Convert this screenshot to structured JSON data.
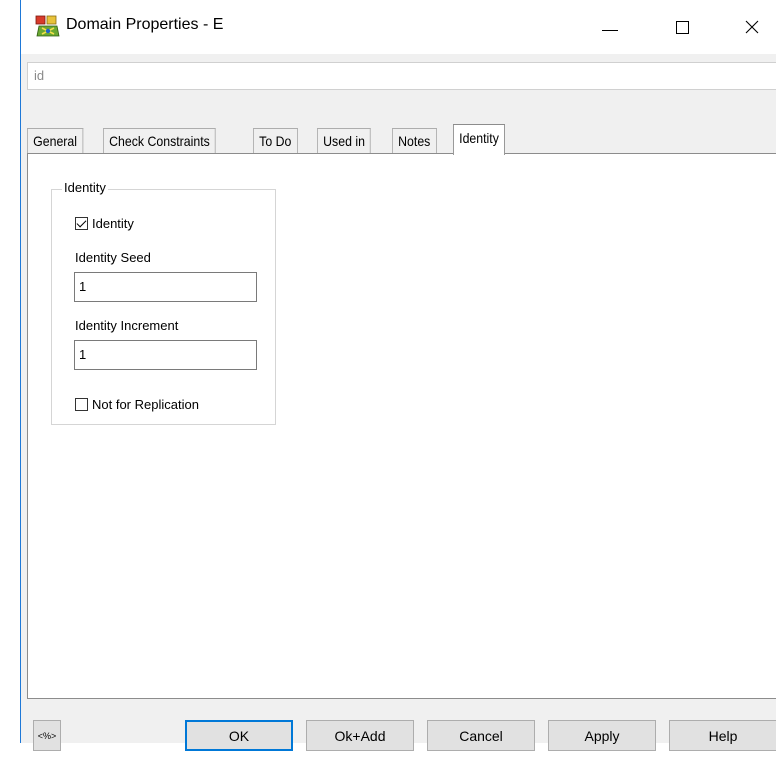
{
  "window": {
    "title": "Domain Properties - E"
  },
  "name_combo": {
    "value": "id"
  },
  "tabs": [
    {
      "label": "General",
      "active": false
    },
    {
      "label": "Check Constraints",
      "active": false
    },
    {
      "label": "To Do",
      "active": false
    },
    {
      "label": "Used in",
      "active": false
    },
    {
      "label": "Notes",
      "active": false
    },
    {
      "label": "Identity",
      "active": true
    }
  ],
  "identity_group": {
    "title": "Identity",
    "identity_checkbox": {
      "label": "Identity",
      "checked": true
    },
    "seed": {
      "label": "Identity Seed",
      "value": "1"
    },
    "increment": {
      "label": "Identity Increment",
      "value": "1"
    },
    "not_for_replication": {
      "label": "Not for Replication",
      "checked": false
    }
  },
  "buttons": {
    "small": "<%>",
    "ok": "OK",
    "ok_add": "Ok+Add",
    "cancel": "Cancel",
    "apply": "Apply",
    "help": "Help"
  },
  "icons": {
    "app": "domain-properties-icon",
    "minimize": "minimize-icon",
    "maximize": "maximize-icon",
    "close": "close-icon"
  },
  "colors": {
    "accent": "#0078d7"
  }
}
